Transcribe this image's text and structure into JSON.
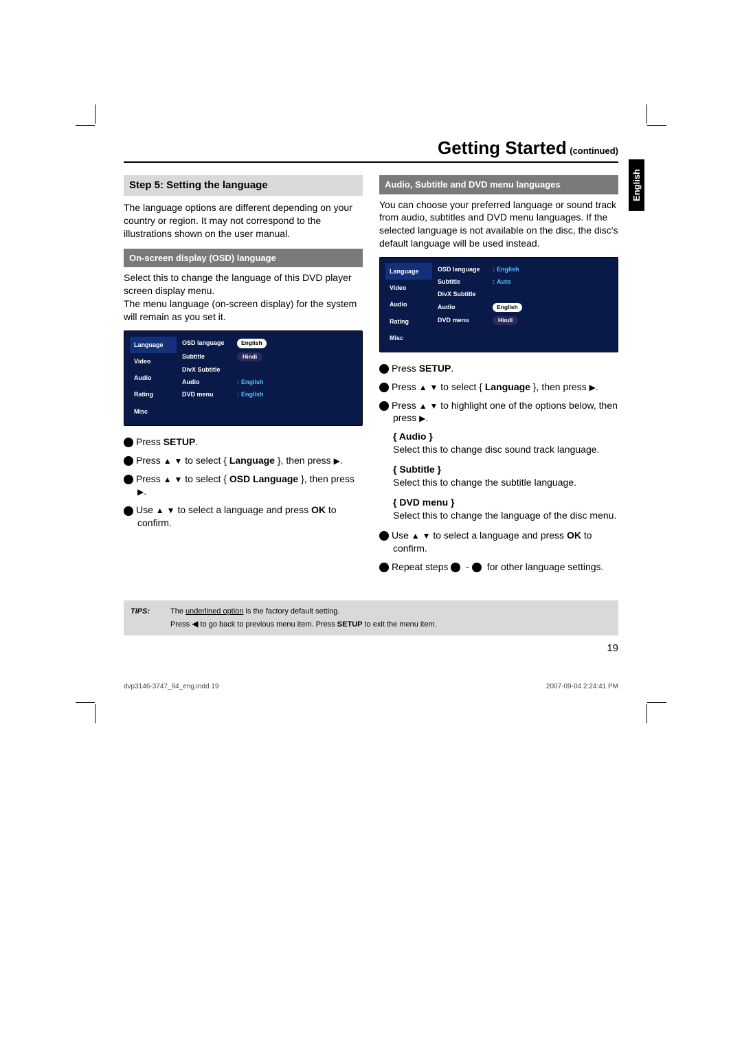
{
  "header": {
    "title": "Getting Started",
    "continued": "(continued)"
  },
  "side_tab": "English",
  "left": {
    "step_heading": "Step 5:  Setting the language",
    "intro": "The language options are different depending on your country or region. It may not correspond to the illustrations shown on the user manual.",
    "osd_heading": "On-screen display (OSD) language",
    "osd_text": "Select this to change the language of this DVD player screen display menu.\nThe menu language (on-screen display) for the system will remain as you set it.",
    "shot": {
      "left_items": [
        "Language",
        "Video",
        "Audio",
        "Rating",
        "Misc"
      ],
      "rows": [
        {
          "lbl": "OSD language",
          "val": "English",
          "style": "box"
        },
        {
          "lbl": "Subtitle",
          "val": "Hindi",
          "style": "dark"
        },
        {
          "lbl": "DivX Subtitle",
          "val": "",
          "style": "none"
        },
        {
          "lbl": "Audio",
          "val": "English",
          "style": "blue",
          "colon": true
        },
        {
          "lbl": "DVD menu",
          "val": "English",
          "style": "blue",
          "colon": true
        }
      ]
    },
    "steps": {
      "s1_a": "Press ",
      "s1_b": "SETUP",
      "s1_c": ".",
      "s2_a": "Press ",
      "s2_b": " to select { ",
      "s2_c": "Language",
      "s2_d": " }, then press ",
      "s2_e": ".",
      "s3_a": "Press ",
      "s3_b": " to select { ",
      "s3_c": "OSD Language",
      "s3_d": " }, then press ",
      "s3_e": ".",
      "s4_a": "Use ",
      "s4_b": " to select a language and press ",
      "s4_c": "OK",
      "s4_d": " to confirm."
    }
  },
  "right": {
    "heading": "Audio, Subtitle and DVD menu languages",
    "intro": "You can choose your preferred language or sound track from audio, subtitles and DVD menu languages. If the selected language is not available on the disc, the disc's default language will be used instead.",
    "shot": {
      "left_items": [
        "Language",
        "Video",
        "Audio",
        "Rating",
        "Misc"
      ],
      "rows": [
        {
          "lbl": "OSD language",
          "val": "English",
          "style": "blue",
          "colon": true
        },
        {
          "lbl": "Subtitle",
          "val": "Auto",
          "style": "blue",
          "colon": true
        },
        {
          "lbl": "DivX Subtitle",
          "val": "",
          "style": "none"
        },
        {
          "lbl": "Audio",
          "val": "English",
          "style": "box"
        },
        {
          "lbl": "DVD menu",
          "val": "Hindi",
          "style": "dark"
        }
      ]
    },
    "steps": {
      "s1_a": "Press ",
      "s1_b": "SETUP",
      "s1_c": ".",
      "s2_a": "Press ",
      "s2_b": " to select { ",
      "s2_c": "Language",
      "s2_d": " }, then press ",
      "s2_e": ".",
      "s3_a": "Press ",
      "s3_b": " to highlight one of the options below, then press ",
      "s3_c": ".",
      "opt_audio_t": "{ Audio }",
      "opt_audio_d": "Select this to change disc sound track language.",
      "opt_sub_t": "{ Subtitle }",
      "opt_sub_d": "Select this to change the subtitle language.",
      "opt_dvd_t": "{ DVD menu }",
      "opt_dvd_d": "Select this to change the language of the disc menu.",
      "s4_a": "Use ",
      "s4_b": " to select a language and press ",
      "s4_c": "OK",
      "s4_d": " to confirm.",
      "s5_a": "Repeat steps ",
      "s5_b": " - ",
      "s5_c": " for other language settings."
    }
  },
  "tips": {
    "label": "TIPS:",
    "line1a": "The ",
    "line1b": "underlined option",
    "line1c": " is the factory default setting.",
    "line2a": "Press ",
    "line2b": " to go back to previous menu item. Press ",
    "line2c": "SETUP",
    "line2d": " to exit the menu item."
  },
  "page_number": "19",
  "footer": {
    "left": "dvp3146-3747_94_eng.indd   19",
    "right": "2007-09-04   2:24:41 PM"
  },
  "glyphs": {
    "up": "▲",
    "down": "▼",
    "left": "◀",
    "right": "▶"
  }
}
